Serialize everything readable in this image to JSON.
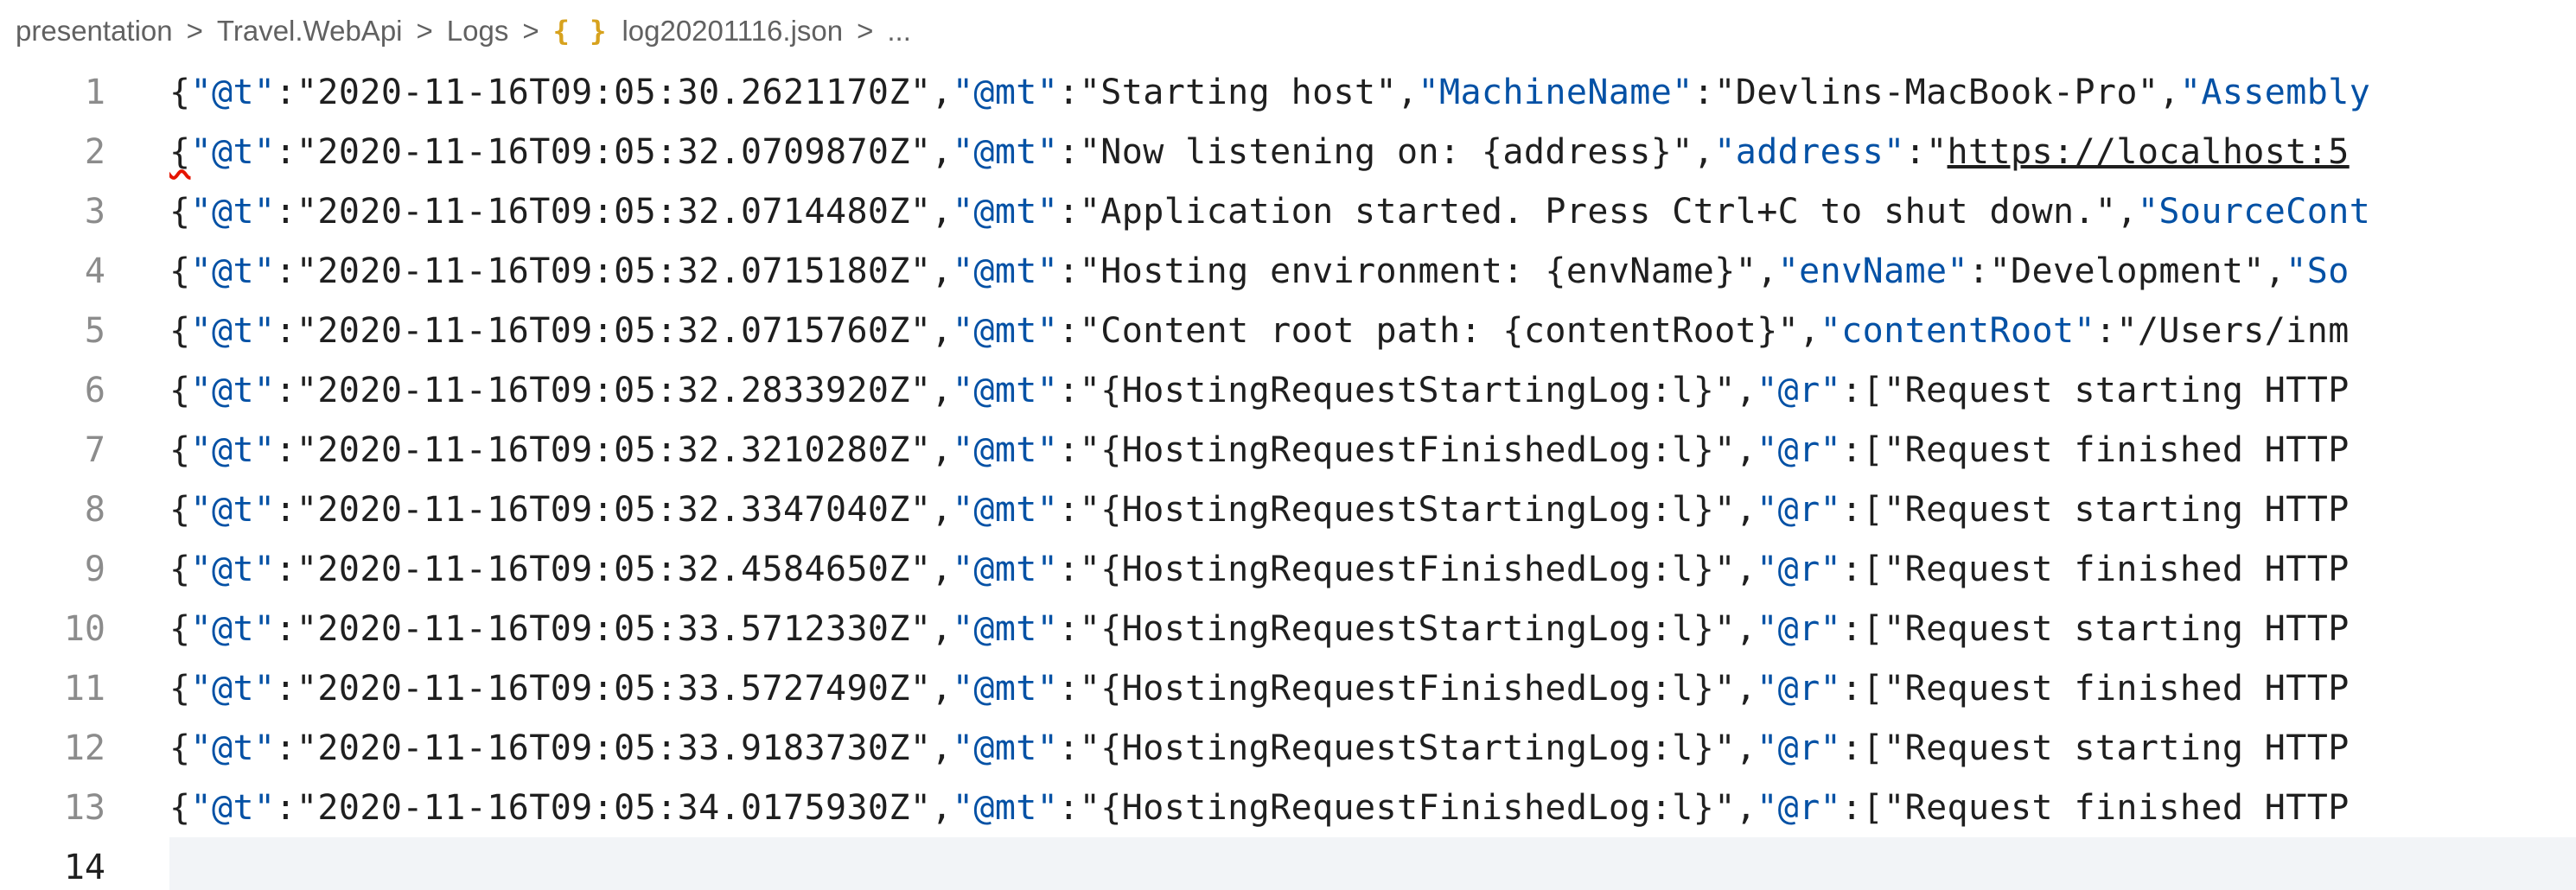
{
  "breadcrumb": {
    "items": [
      "presentation",
      "Travel.WebApi",
      "Logs"
    ],
    "file_icon": "{ }",
    "file_name": "log20201116.json",
    "ellipsis": "...",
    "separator": ">"
  },
  "editor": {
    "lines": [
      {
        "num": "1",
        "tokens": [
          {
            "t": "{",
            "c": "p"
          },
          {
            "t": "\"@t\"",
            "c": "k"
          },
          {
            "t": ":",
            "c": "p"
          },
          {
            "t": "\"2020-11-16T09:05:30.2621170Z\"",
            "c": "v"
          },
          {
            "t": ",",
            "c": "p"
          },
          {
            "t": "\"@mt\"",
            "c": "k"
          },
          {
            "t": ":",
            "c": "p"
          },
          {
            "t": "\"Starting host\"",
            "c": "v"
          },
          {
            "t": ",",
            "c": "p"
          },
          {
            "t": "\"MachineName\"",
            "c": "k"
          },
          {
            "t": ":",
            "c": "p"
          },
          {
            "t": "\"Devlins-MacBook-Pro\"",
            "c": "v"
          },
          {
            "t": ",",
            "c": "p"
          },
          {
            "t": "\"Assembly",
            "c": "k"
          }
        ]
      },
      {
        "num": "2",
        "squiggle_first": true,
        "tokens": [
          {
            "t": "{",
            "c": "p sq"
          },
          {
            "t": "\"@t\"",
            "c": "k"
          },
          {
            "t": ":",
            "c": "p"
          },
          {
            "t": "\"2020-11-16T09:05:32.0709870Z\"",
            "c": "v"
          },
          {
            "t": ",",
            "c": "p"
          },
          {
            "t": "\"@mt\"",
            "c": "k"
          },
          {
            "t": ":",
            "c": "p"
          },
          {
            "t": "\"Now listening on: {address}\"",
            "c": "v"
          },
          {
            "t": ",",
            "c": "p"
          },
          {
            "t": "\"address\"",
            "c": "k"
          },
          {
            "t": ":",
            "c": "p"
          },
          {
            "t": "\"",
            "c": "v"
          },
          {
            "t": "https://localhost:5",
            "c": "v u"
          }
        ]
      },
      {
        "num": "3",
        "tokens": [
          {
            "t": "{",
            "c": "p"
          },
          {
            "t": "\"@t\"",
            "c": "k"
          },
          {
            "t": ":",
            "c": "p"
          },
          {
            "t": "\"2020-11-16T09:05:32.0714480Z\"",
            "c": "v"
          },
          {
            "t": ",",
            "c": "p"
          },
          {
            "t": "\"@mt\"",
            "c": "k"
          },
          {
            "t": ":",
            "c": "p"
          },
          {
            "t": "\"Application started. Press Ctrl+C to shut down.\"",
            "c": "v"
          },
          {
            "t": ",",
            "c": "p"
          },
          {
            "t": "\"SourceCont",
            "c": "k"
          }
        ]
      },
      {
        "num": "4",
        "tokens": [
          {
            "t": "{",
            "c": "p"
          },
          {
            "t": "\"@t\"",
            "c": "k"
          },
          {
            "t": ":",
            "c": "p"
          },
          {
            "t": "\"2020-11-16T09:05:32.0715180Z\"",
            "c": "v"
          },
          {
            "t": ",",
            "c": "p"
          },
          {
            "t": "\"@mt\"",
            "c": "k"
          },
          {
            "t": ":",
            "c": "p"
          },
          {
            "t": "\"Hosting environment: {envName}\"",
            "c": "v"
          },
          {
            "t": ",",
            "c": "p"
          },
          {
            "t": "\"envName\"",
            "c": "k"
          },
          {
            "t": ":",
            "c": "p"
          },
          {
            "t": "\"Development\"",
            "c": "v"
          },
          {
            "t": ",",
            "c": "p"
          },
          {
            "t": "\"So",
            "c": "k"
          }
        ]
      },
      {
        "num": "5",
        "tokens": [
          {
            "t": "{",
            "c": "p"
          },
          {
            "t": "\"@t\"",
            "c": "k"
          },
          {
            "t": ":",
            "c": "p"
          },
          {
            "t": "\"2020-11-16T09:05:32.0715760Z\"",
            "c": "v"
          },
          {
            "t": ",",
            "c": "p"
          },
          {
            "t": "\"@mt\"",
            "c": "k"
          },
          {
            "t": ":",
            "c": "p"
          },
          {
            "t": "\"Content root path: {contentRoot}\"",
            "c": "v"
          },
          {
            "t": ",",
            "c": "p"
          },
          {
            "t": "\"contentRoot\"",
            "c": "k"
          },
          {
            "t": ":",
            "c": "p"
          },
          {
            "t": "\"/Users/inm",
            "c": "v"
          }
        ]
      },
      {
        "num": "6",
        "tokens": [
          {
            "t": "{",
            "c": "p"
          },
          {
            "t": "\"@t\"",
            "c": "k"
          },
          {
            "t": ":",
            "c": "p"
          },
          {
            "t": "\"2020-11-16T09:05:32.2833920Z\"",
            "c": "v"
          },
          {
            "t": ",",
            "c": "p"
          },
          {
            "t": "\"@mt\"",
            "c": "k"
          },
          {
            "t": ":",
            "c": "p"
          },
          {
            "t": "\"{HostingRequestStartingLog:l}\"",
            "c": "v"
          },
          {
            "t": ",",
            "c": "p"
          },
          {
            "t": "\"@r\"",
            "c": "k"
          },
          {
            "t": ":",
            "c": "p"
          },
          {
            "t": "[\"Request starting HTTP",
            "c": "v"
          }
        ]
      },
      {
        "num": "7",
        "tokens": [
          {
            "t": "{",
            "c": "p"
          },
          {
            "t": "\"@t\"",
            "c": "k"
          },
          {
            "t": ":",
            "c": "p"
          },
          {
            "t": "\"2020-11-16T09:05:32.3210280Z\"",
            "c": "v"
          },
          {
            "t": ",",
            "c": "p"
          },
          {
            "t": "\"@mt\"",
            "c": "k"
          },
          {
            "t": ":",
            "c": "p"
          },
          {
            "t": "\"{HostingRequestFinishedLog:l}\"",
            "c": "v"
          },
          {
            "t": ",",
            "c": "p"
          },
          {
            "t": "\"@r\"",
            "c": "k"
          },
          {
            "t": ":",
            "c": "p"
          },
          {
            "t": "[\"Request finished HTTP",
            "c": "v"
          }
        ]
      },
      {
        "num": "8",
        "tokens": [
          {
            "t": "{",
            "c": "p"
          },
          {
            "t": "\"@t\"",
            "c": "k"
          },
          {
            "t": ":",
            "c": "p"
          },
          {
            "t": "\"2020-11-16T09:05:32.3347040Z\"",
            "c": "v"
          },
          {
            "t": ",",
            "c": "p"
          },
          {
            "t": "\"@mt\"",
            "c": "k"
          },
          {
            "t": ":",
            "c": "p"
          },
          {
            "t": "\"{HostingRequestStartingLog:l}\"",
            "c": "v"
          },
          {
            "t": ",",
            "c": "p"
          },
          {
            "t": "\"@r\"",
            "c": "k"
          },
          {
            "t": ":",
            "c": "p"
          },
          {
            "t": "[\"Request starting HTTP",
            "c": "v"
          }
        ]
      },
      {
        "num": "9",
        "tokens": [
          {
            "t": "{",
            "c": "p"
          },
          {
            "t": "\"@t\"",
            "c": "k"
          },
          {
            "t": ":",
            "c": "p"
          },
          {
            "t": "\"2020-11-16T09:05:32.4584650Z\"",
            "c": "v"
          },
          {
            "t": ",",
            "c": "p"
          },
          {
            "t": "\"@mt\"",
            "c": "k"
          },
          {
            "t": ":",
            "c": "p"
          },
          {
            "t": "\"{HostingRequestFinishedLog:l}\"",
            "c": "v"
          },
          {
            "t": ",",
            "c": "p"
          },
          {
            "t": "\"@r\"",
            "c": "k"
          },
          {
            "t": ":",
            "c": "p"
          },
          {
            "t": "[\"Request finished HTTP",
            "c": "v"
          }
        ]
      },
      {
        "num": "10",
        "tokens": [
          {
            "t": "{",
            "c": "p"
          },
          {
            "t": "\"@t\"",
            "c": "k"
          },
          {
            "t": ":",
            "c": "p"
          },
          {
            "t": "\"2020-11-16T09:05:33.5712330Z\"",
            "c": "v"
          },
          {
            "t": ",",
            "c": "p"
          },
          {
            "t": "\"@mt\"",
            "c": "k"
          },
          {
            "t": ":",
            "c": "p"
          },
          {
            "t": "\"{HostingRequestStartingLog:l}\"",
            "c": "v"
          },
          {
            "t": ",",
            "c": "p"
          },
          {
            "t": "\"@r\"",
            "c": "k"
          },
          {
            "t": ":",
            "c": "p"
          },
          {
            "t": "[\"Request starting HTTP",
            "c": "v"
          }
        ]
      },
      {
        "num": "11",
        "tokens": [
          {
            "t": "{",
            "c": "p"
          },
          {
            "t": "\"@t\"",
            "c": "k"
          },
          {
            "t": ":",
            "c": "p"
          },
          {
            "t": "\"2020-11-16T09:05:33.5727490Z\"",
            "c": "v"
          },
          {
            "t": ",",
            "c": "p"
          },
          {
            "t": "\"@mt\"",
            "c": "k"
          },
          {
            "t": ":",
            "c": "p"
          },
          {
            "t": "\"{HostingRequestFinishedLog:l}\"",
            "c": "v"
          },
          {
            "t": ",",
            "c": "p"
          },
          {
            "t": "\"@r\"",
            "c": "k"
          },
          {
            "t": ":",
            "c": "p"
          },
          {
            "t": "[\"Request finished HTTP",
            "c": "v"
          }
        ]
      },
      {
        "num": "12",
        "tokens": [
          {
            "t": "{",
            "c": "p"
          },
          {
            "t": "\"@t\"",
            "c": "k"
          },
          {
            "t": ":",
            "c": "p"
          },
          {
            "t": "\"2020-11-16T09:05:33.9183730Z\"",
            "c": "v"
          },
          {
            "t": ",",
            "c": "p"
          },
          {
            "t": "\"@mt\"",
            "c": "k"
          },
          {
            "t": ":",
            "c": "p"
          },
          {
            "t": "\"{HostingRequestStartingLog:l}\"",
            "c": "v"
          },
          {
            "t": ",",
            "c": "p"
          },
          {
            "t": "\"@r\"",
            "c": "k"
          },
          {
            "t": ":",
            "c": "p"
          },
          {
            "t": "[\"Request starting HTTP",
            "c": "v"
          }
        ]
      },
      {
        "num": "13",
        "tokens": [
          {
            "t": "{",
            "c": "p"
          },
          {
            "t": "\"@t\"",
            "c": "k"
          },
          {
            "t": ":",
            "c": "p"
          },
          {
            "t": "\"2020-11-16T09:05:34.0175930Z\"",
            "c": "v"
          },
          {
            "t": ",",
            "c": "p"
          },
          {
            "t": "\"@mt\"",
            "c": "k"
          },
          {
            "t": ":",
            "c": "p"
          },
          {
            "t": "\"{HostingRequestFinishedLog:l}\"",
            "c": "v"
          },
          {
            "t": ",",
            "c": "p"
          },
          {
            "t": "\"@r\"",
            "c": "k"
          },
          {
            "t": ":",
            "c": "p"
          },
          {
            "t": "[\"Request finished HTTP",
            "c": "v"
          }
        ]
      },
      {
        "num": "14",
        "current": true,
        "tokens": []
      }
    ]
  },
  "colors": {
    "key": "#0451a5",
    "text": "#1f1f1f",
    "line_number": "#8c8c8c",
    "current_line_bg": "#f2f4f7",
    "json_icon": "#d7a21e",
    "error_squiggle": "#e51400"
  }
}
